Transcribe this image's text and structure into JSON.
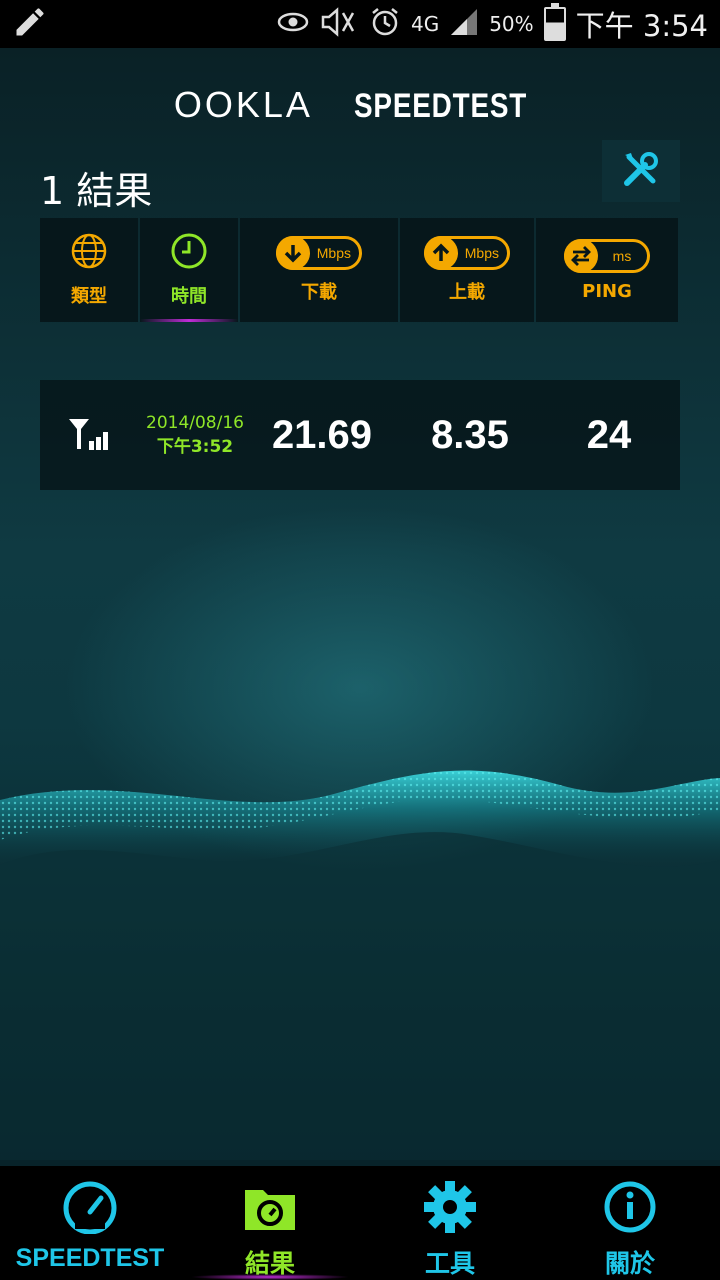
{
  "status_bar": {
    "network": "4G",
    "battery": "50%",
    "time": "下午 3:54"
  },
  "header": {
    "brand_ookla": "OOKLA",
    "brand_speedtest": "SPEEDTEST",
    "results_title": "1 結果"
  },
  "columns": {
    "type_label": "類型",
    "time_label": "時間",
    "download_label": "下載",
    "download_unit": "Mbps",
    "upload_label": "上載",
    "upload_unit": "Mbps",
    "ping_label": "PING",
    "ping_unit": "ms"
  },
  "results": [
    {
      "connection_icon": "cellular-signal-icon",
      "date": "2014/08/16",
      "time": "下午3:52",
      "download": "21.69",
      "upload": "8.35",
      "ping": "24"
    }
  ],
  "bottom_nav": {
    "speedtest": "SPEEDTEST",
    "results": "結果",
    "tools": "工具",
    "about": "關於"
  },
  "colors": {
    "accent_orange": "#f4a800",
    "accent_green": "#8fe628",
    "accent_cyan": "#1fc6e8",
    "accent_purple": "#c02cd8"
  }
}
